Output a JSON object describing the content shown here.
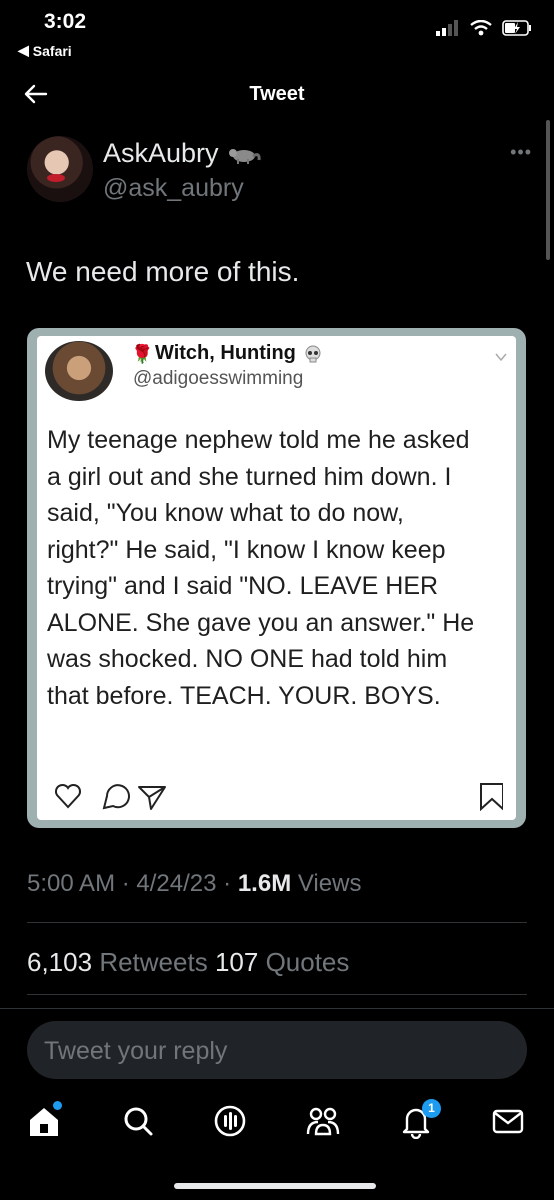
{
  "status_bar": {
    "time": "3:02",
    "back_app": "Safari"
  },
  "header": {
    "title": "Tweet"
  },
  "tweet": {
    "author_name": "AskAubry",
    "author_badge_icon": "raccoon-emoji",
    "author_handle": "@ask_aubry",
    "text": "We need more of this."
  },
  "embedded": {
    "name": "Witch, Hunting",
    "handle": "@adigoesswimming",
    "lines": [
      "My teenage nephew told me he asked",
      "a girl out and she turned him down. I",
      "said, \"You know what to do now,",
      "right?\" He said, \"I know I know keep",
      "trying\" and I said \"NO. LEAVE HER",
      "ALONE. She gave you an answer.\" He",
      "was shocked. NO ONE had told him",
      "that before. TEACH. YOUR. BOYS."
    ]
  },
  "meta": {
    "time": "5:00 AM",
    "date": "4/24/23",
    "views_count": "1.6M",
    "views_label": "Views",
    "sep": "·"
  },
  "stats": {
    "retweets_count": "6,103",
    "retweets_label": "Retweets",
    "quotes_count": "107",
    "quotes_label": "Quotes"
  },
  "reply": {
    "placeholder": "Tweet your reply"
  },
  "nav": {
    "notifications_badge": "1",
    "accent_color": "#1d9bf0"
  }
}
